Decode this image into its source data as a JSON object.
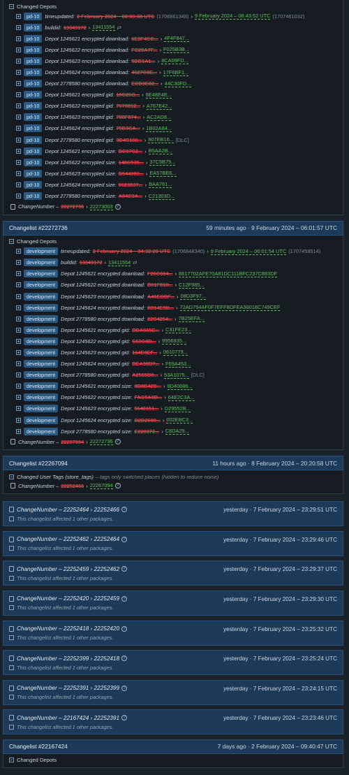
{
  "first": {
    "section_title": "Changed Depots",
    "rows": [
      {
        "badge": "pd-10",
        "key": "timeupdated:",
        "old": "2 February 2024 – 08:09:08 UTC",
        "old_sub": "(1706861348)",
        "new": "9 February 2024 – 06:43:52 UTC",
        "new_sub": "(1707461032)"
      },
      {
        "badge": "pd-10",
        "key": "buildid:",
        "old": "13343172",
        "new": "13411554",
        "new_sub": "⇄"
      },
      {
        "badge": "pd-10",
        "key": "Depot 1245621 encrypted download:",
        "old": "6E3F4CC...",
        "new": "4F4F847..."
      },
      {
        "badge": "pd-10",
        "key": "Depot 1245622 encrypted download:",
        "old": "FC20A7F...",
        "new": "F025B3B..."
      },
      {
        "badge": "pd-10",
        "key": "Depot 1245623 encrypted download:",
        "old": "5DD1A1...",
        "new": "8CA09FD..."
      },
      {
        "badge": "pd-10",
        "key": "Depot 1245624 encrypted download:",
        "old": "4627C8E...",
        "new": "17F6BF1..."
      },
      {
        "badge": "pd-10",
        "key": "Depot 2778580 encrypted download:",
        "old": "ECD3E82...",
        "new": "44C30FD..."
      },
      {
        "badge": "pd-10",
        "key": "Depot 1245621 encrypted gid:",
        "old": "10C26G...",
        "new": "6E48E4E..."
      },
      {
        "badge": "pd-10",
        "key": "Depot 1245622 encrypted gid:",
        "old": "7678812...",
        "new": "A767E42..."
      },
      {
        "badge": "pd-10",
        "key": "Depot 1245623 encrypted gid:",
        "old": "788F874...",
        "new": "AC2AD8..."
      },
      {
        "badge": "pd-10",
        "key": "Depot 1245624 encrypted gid:",
        "old": "75B3CA...",
        "new": "1B02A84..."
      },
      {
        "badge": "pd-10",
        "key": "Depot 2778580 encrypted gid:",
        "old": "3D4C108...",
        "new": "807EB16...",
        "new_sub": "[DLC]"
      },
      {
        "badge": "pd-10",
        "key": "Depot 1245621 encrypted size:",
        "old": "DC97C2...",
        "new": "B5AA2B..."
      },
      {
        "badge": "pd-10",
        "key": "Depot 1245622 encrypted size:",
        "old": "148C535...",
        "new": "37C5B79..."
      },
      {
        "badge": "pd-10",
        "key": "Depot 1245623 encrypted size:",
        "old": "B544083...",
        "new": "EA57BE6..."
      },
      {
        "badge": "pd-10",
        "key": "Depot 1245624 encrypted size:",
        "old": "0623837...",
        "new": "BAA761..."
      },
      {
        "badge": "pd-10",
        "key": "Depot 2778580 encrypted size:",
        "old": "A84C3A...",
        "new": "C21303D..."
      }
    ],
    "change_number": {
      "label": "ChangeNumber –",
      "old": "22272736",
      "new": "22273003"
    }
  },
  "second": {
    "title": "Changelist #22272736",
    "time": "59 minutes ago · 9 February 2024 – 06:01:57 UTC",
    "section_title": "Changed Depots",
    "rows": [
      {
        "badge": "development",
        "key": "timeupdated:",
        "old": "2 February 2024 – 04:32:20 UTC",
        "old_sub": "(1706848340)",
        "new": "9 February 2024 – 06:01:54 UTC",
        "new_sub": "(1707458514)"
      },
      {
        "badge": "development",
        "key": "buildid:",
        "old": "13343172",
        "new": "13411554",
        "new_sub": "⇄"
      },
      {
        "badge": "development",
        "key": "Depot 1245621 encrypted download:",
        "old": "F26C304...",
        "new": "8617702AFE70A81DC111BFC237C883DF"
      },
      {
        "badge": "development",
        "key": "Depot 1245622 encrypted download:",
        "old": "D01F818...",
        "new": "C12F985..."
      },
      {
        "badge": "development",
        "key": "Depot 1245623 encrypted download:",
        "old": "A46ECBF...",
        "new": "08D3F97..."
      },
      {
        "badge": "development",
        "key": "Depot 1245624 encrypted download:",
        "old": "0B14E5B...",
        "new": "72AD794AF0F7EFF8DFEA36018C749CEF"
      },
      {
        "badge": "development",
        "key": "Depot 2778580 encrypted download:",
        "old": "22C4254...",
        "new": "7B25EFA..."
      },
      {
        "badge": "development",
        "key": "Depot 1245621 encrypted gid:",
        "old": "BDA665E...",
        "new": "C31FE23..."
      },
      {
        "badge": "development",
        "key": "Depot 1245622 encrypted gid:",
        "old": "C63C8B...",
        "new": "9956835..."
      },
      {
        "badge": "development",
        "key": "Depot 1245623 encrypted gid:",
        "old": "164E8EF...",
        "new": "0610779..."
      },
      {
        "badge": "development",
        "key": "Depot 1245624 encrypted gid:",
        "old": "DEA38B7...",
        "new": "F69A453..."
      },
      {
        "badge": "development",
        "key": "Depot 2778580 encrypted gid:",
        "old": "A2565D0...",
        "new": "53A1075...",
        "new_sub": "[DLC]"
      },
      {
        "badge": "development",
        "key": "Depot 1245621 encrypted size:",
        "old": "0D8B42B...",
        "new": "8D40086..."
      },
      {
        "badge": "development",
        "key": "Depot 1245622 encrypted size:",
        "old": "FAC5A0D...",
        "new": "64E2C3A..."
      },
      {
        "badge": "development",
        "key": "Depot 1245623 encrypted size:",
        "old": "5640151...",
        "new": "D29552B..."
      },
      {
        "badge": "development",
        "key": "Depot 1245624 encrypted size:",
        "old": "B2B2608...",
        "new": "002EBC3..."
      },
      {
        "badge": "development",
        "key": "Depot 2778580 encrypted size:",
        "old": "E228372...",
        "new": "C8DA29..."
      }
    ],
    "change_number": {
      "label": "ChangeNumber –",
      "old": "22267094",
      "new": "22272736"
    }
  },
  "third": {
    "title": "Changelist #22267094",
    "time": "11 hours ago · 8 February 2024 – 20:20:58 UTC",
    "tags_line": "Changed User Tags (store_tags)",
    "tags_note": "– tags only switched places (hidden to reduce noise)",
    "change_number": {
      "label": "ChangeNumber –",
      "old": "22252466",
      "new": "22267094"
    }
  },
  "minis": [
    {
      "label": "ChangeNumber – 22252464 › 22252466",
      "time": "yesterday · 7 February 2024 – 23:29:51 UTC",
      "note": "This changelist affected 1 other packages."
    },
    {
      "label": "ChangeNumber – 22252462 › 22252464",
      "time": "yesterday · 7 February 2024 – 23:29:46 UTC",
      "note": "This changelist affected 1 other packages."
    },
    {
      "label": "ChangeNumber – 22252459 › 22252462",
      "time": "yesterday · 7 February 2024 – 23:29:37 UTC",
      "note": "This changelist affected 1 other packages."
    },
    {
      "label": "ChangeNumber – 22252420 › 22252459",
      "time": "yesterday · 7 February 2024 – 23:29:30 UTC",
      "note": "This changelist affected 1 other packages."
    },
    {
      "label": "ChangeNumber – 22252418 › 22252420",
      "time": "yesterday · 7 February 2024 – 23:25:32 UTC",
      "note": "This changelist affected 1 other packages."
    },
    {
      "label": "ChangeNumber – 22252399 › 22252418",
      "time": "yesterday · 7 February 2024 – 23:25:24 UTC",
      "note": "This changelist affected 1 other packages."
    },
    {
      "label": "ChangeNumber – 22252391 › 22252399",
      "time": "yesterday · 7 February 2024 – 23:24:15 UTC",
      "note": "This changelist affected 1 other packages."
    },
    {
      "label": "ChangeNumber – 22167424 › 22252391",
      "time": "yesterday · 7 February 2024 – 23:23:46 UTC",
      "note": "This changelist affected 1 other packages."
    }
  ],
  "last": {
    "title": "Changelist #22167424",
    "time": "7 days ago · 2 February 2024 – 09:40:47 UTC",
    "section_title": "Changed Depots"
  }
}
